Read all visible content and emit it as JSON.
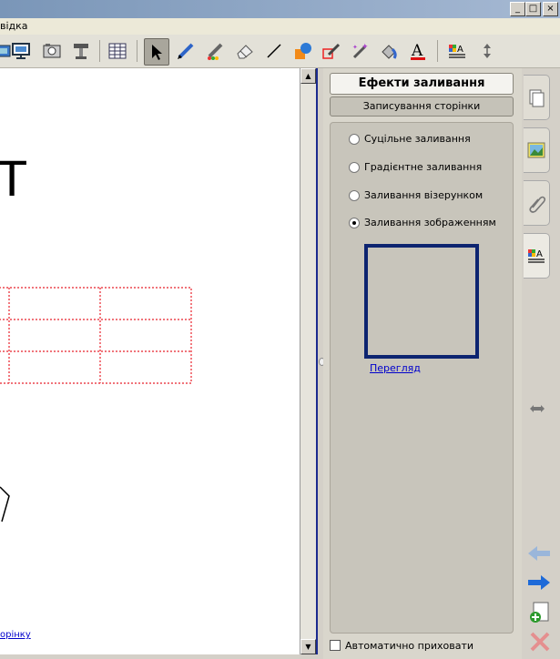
{
  "menu": {
    "help": "відка"
  },
  "window": {
    "minimize": "_",
    "maximize": "□",
    "close": "×"
  },
  "canvas": {
    "big_letter": "T",
    "link_fragment": "орінку"
  },
  "panel": {
    "header_title": "Ефекти заливання",
    "subheader": "Записування сторінки",
    "options": [
      {
        "label": "Суцільне заливання",
        "selected": false
      },
      {
        "label": "Градієнтне заливання",
        "selected": false
      },
      {
        "label": "Заливання візерунком",
        "selected": false
      },
      {
        "label": "Заливання зображенням",
        "selected": true
      }
    ],
    "browse_link": "Перегляд",
    "autohide_label": "Автоматично приховати",
    "autohide_checked": false
  },
  "colors": {
    "accent_blue": "#1b2a8f",
    "table_border": "#e8202a",
    "preview_border": "#0d2470",
    "link": "#0000cc"
  }
}
